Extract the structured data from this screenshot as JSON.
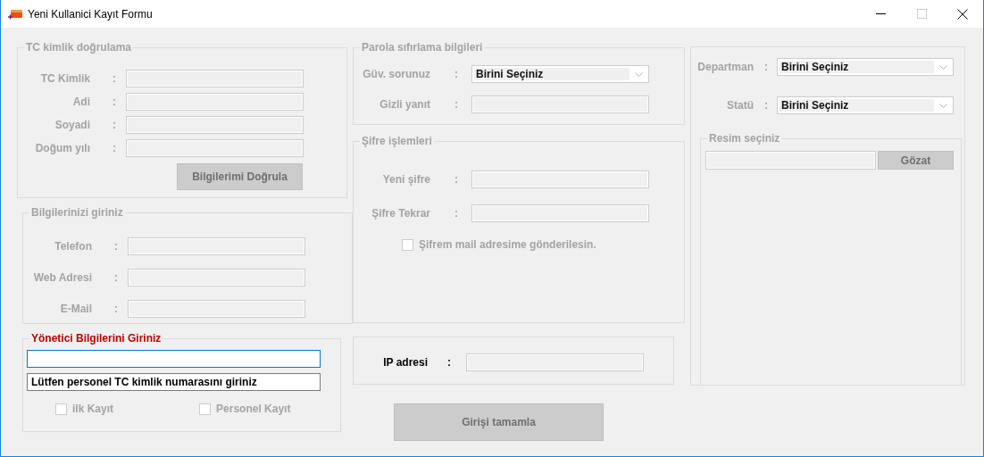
{
  "window": {
    "title": "Yeni Kullanici Kayıt Formu"
  },
  "tc_verification": {
    "title": "TC kimlik doğrulama",
    "disabled": true,
    "rows": [
      {
        "kind": "text",
        "label": "TC Kimlik",
        "colon": ":",
        "disabled": true
      },
      {
        "kind": "text",
        "label": "Adi",
        "colon": ":",
        "disabled": true
      },
      {
        "kind": "text",
        "label": "Soyadi",
        "colon": ":",
        "disabled": true
      },
      {
        "kind": "text",
        "label": "Doğum yılı",
        "colon": ":",
        "disabled": true
      }
    ],
    "button": {
      "label": "Bilgilerimi Doğrula",
      "disabled": true
    }
  },
  "contact_info": {
    "title": "Bilgilerinizi giriniz",
    "disabled": true,
    "rows": [
      {
        "kind": "text",
        "label": "Telefon",
        "colon": ":",
        "disabled": true
      },
      {
        "kind": "text",
        "label": "Web Adresi",
        "colon": ":",
        "disabled": true
      },
      {
        "kind": "text",
        "label": "E-Mail",
        "colon": ":",
        "disabled": true
      }
    ]
  },
  "admin": {
    "title": "Yönetici Bilgilerini Giriniz",
    "disabled": false,
    "emphasis": true,
    "inputs": [
      {
        "focused": true
      },
      {
        "value": "Lütfen personel TC kimlik numarasını giriniz",
        "focused": false
      }
    ],
    "checkboxes": [
      {
        "label": "ilk Kayıt",
        "checked": false,
        "disabled": true
      },
      {
        "label": "Personel Kayıt",
        "checked": false,
        "disabled": true
      }
    ]
  },
  "password_reset": {
    "title": "Parola sıfırlama bilgileri",
    "disabled": true,
    "rows": [
      {
        "kind": "combo",
        "label": "Güv. sorunuz",
        "colon": ":",
        "value": "Birini Seçiniz",
        "disabled": true
      },
      {
        "kind": "text",
        "label": "Gizli yanıt",
        "colon": ":",
        "disabled": true
      }
    ]
  },
  "password_ops": {
    "title": "Şifre işlemleri",
    "disabled": true,
    "rows": [
      {
        "kind": "text",
        "label": "Yeni şifre",
        "colon": ":",
        "disabled": true
      },
      {
        "kind": "text",
        "label": "Şifre Tekrar",
        "colon": ":",
        "disabled": true
      }
    ],
    "checkbox": {
      "label": "Şifrem mail adresime gönderilesin.",
      "checked": false,
      "disabled": true
    }
  },
  "ip": {
    "rows": [
      {
        "kind": "text",
        "label": "IP adresi",
        "colon": ":",
        "disabled": false,
        "read_only": true
      }
    ]
  },
  "finish_button": {
    "label": "Girişi tamamla",
    "disabled": true
  },
  "profile": {
    "rows": [
      {
        "kind": "combo",
        "label": "Departman",
        "colon": ":",
        "value": "Birini Seçiniz",
        "disabled": true
      },
      {
        "kind": "combo",
        "label": "Statü",
        "colon": ":",
        "value": "Birini Seçiniz",
        "disabled": true
      }
    ],
    "picture_group": {
      "title": "Resim seçiniz",
      "disabled": true,
      "button": {
        "label": "Gözat",
        "disabled": true
      }
    }
  }
}
